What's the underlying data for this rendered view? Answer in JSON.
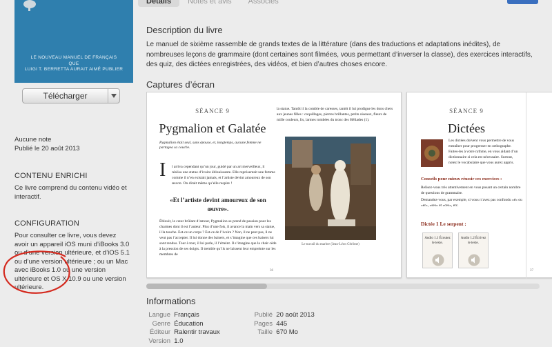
{
  "tabs": [
    "Détails",
    "Notes et avis",
    "Associés"
  ],
  "cover": {
    "line1": "LE NOUVEAU MANUEL DE FRANÇAIS",
    "line2": "QUE",
    "line3": "LUIGI T. BERRETTA AURAIT AIMÉ PUBLIER"
  },
  "download": {
    "label": "Télécharger"
  },
  "meta": {
    "rating": "Aucune note",
    "published": "Publié le 20 août 2013"
  },
  "enriched": {
    "title": "CONTENU ENRICHI",
    "text": "Ce livre comprend du contenu vidéo et interactif."
  },
  "config": {
    "title": "CONFIGURATION",
    "text": "Pour consulter ce livre, vous devez avoir un appareil iOS muni d’iBooks 3.0 ou d’une version ultérieure, et d’iOS 5.1 ou d’une version ultérieure ; ou un Mac avec iBooks 1.0 ou une version ultérieure et OS X 10.9 ou une version ultérieure."
  },
  "description": {
    "title": "Description du livre",
    "text": "Le manuel de sixième rassemble de grands textes de la littérature (dans des traductions et adaptations inédites), de nombreuses leçons de grammaire (dont certaines sont filmées, vous permettant d’inverser la classe), des exercices interactifs, des quiz, des dictées enregistrées, des vidéos, et bien d’autres choses encore."
  },
  "screenshots": {
    "title": "Captures d’écran",
    "page1": {
      "seance": "Séance 9",
      "title": "Pygmalion et Galatée",
      "intro": "Pygmalion était seul, sans épouse, et, longtemps, aucune femme ne partagea sa couche.",
      "para1": "l arriva cependant qu’un jour, guidé par un art merveilleux, il réalisa une statue d’ivoire éblouissante. Elle représentait une femme comme il n’en existait jamais, et l’artiste devint amoureux de son œuvre. On dirait même qu’elle respire !",
      "quote": "«Et l’artiste devint amoureux de son œuvre».",
      "para2": "Éblouit, le cœur brûlant d’amour, Pygmalion se prend de passion pour les charmes dont il est l’auteur. Plus d’une fois, il avance la main vers sa statue, il la touche. Est-ce un corps ? Est-ce de l’ivoire ? Non, il ne peut pas, il ne veut pas l’accepter. Il lui donne des baisers, et s’imagine que ces baisers lui sont rendus. Tour à tour, il lui parle, il l’étreint. Il s’imagine que la chair cède à la pression de ses doigts. Il tremble qu’ils ne laissent leur empreinte sur les membres de",
      "col2": "la statue. Tantôt il la comble de caresses, tantôt il lui prodigue les dons chers aux jeunes filles : coquillages, pierres brillantes, petits oiseaux, fleurs de mille couleurs, lis, larmes tombées du tronc des Héliades (1).",
      "caption": "Le travail du marbre (Jean-Léon Gérôme)",
      "pagenum": "36"
    },
    "page2": {
      "seance": "Séance 9",
      "title": "Dictées",
      "intro": "Les dictées doivent vous permettre de vous entraîner pour progresser en orthographe. Faites-les à votre rythme, en vous aidant d’un dictionnaire si cela est nécessaire. Surtout, notez le vocabulaire que vous aurez appris.",
      "advice_title": "Conseils pour mieux réussir ces exercices :",
      "advice1": "Relisez-vous très attentivement en vous posant un certain nombre de questions de grammaire.",
      "advice2": "Demandez-vous, par exemple, si vous n’avez pas confondu «é» ou «er», «ses» et «ces», etc.",
      "dictee_title": "Dictée 1 Le serpent :",
      "audio1": "Audio 1.1 Écoutez le texte.",
      "audio2": "Audio 1.2 Écrivez le texte.",
      "pagenum": "37"
    }
  },
  "info": {
    "title": "Informations",
    "left": [
      {
        "k": "Langue",
        "v": "Français"
      },
      {
        "k": "Genre",
        "v": "Éducation"
      },
      {
        "k": "Éditeur",
        "v": "Ralentir travaux"
      },
      {
        "k": "Version",
        "v": "1.0"
      }
    ],
    "right": [
      {
        "k": "Publié",
        "v": "20 août 2013"
      },
      {
        "k": "Pages",
        "v": "445"
      },
      {
        "k": "Taille",
        "v": "670 Mo"
      }
    ]
  },
  "colors": {
    "cover": "#2f7fae",
    "annotation": "#d42a1f",
    "accent_button": "#3a6fbf"
  }
}
